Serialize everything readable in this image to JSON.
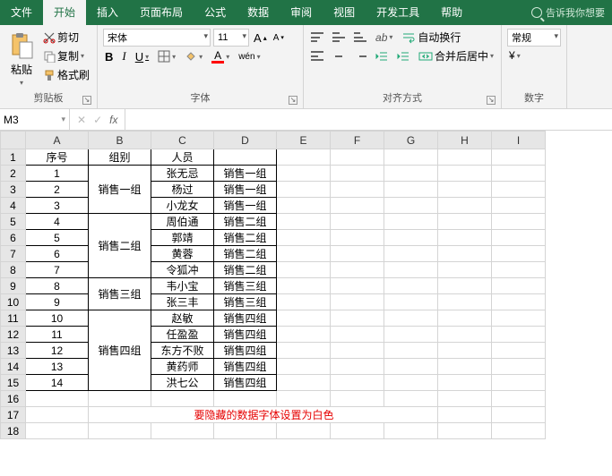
{
  "tabs": {
    "items": [
      "文件",
      "开始",
      "插入",
      "页面布局",
      "公式",
      "数据",
      "审阅",
      "视图",
      "开发工具",
      "帮助"
    ],
    "active_index": 1,
    "tell_me": "告诉我你想要"
  },
  "ribbon": {
    "clipboard": {
      "label": "剪贴板",
      "paste": "粘贴",
      "cut": "剪切",
      "copy": "复制",
      "format_painter": "格式刷"
    },
    "font": {
      "label": "字体",
      "name": "宋体",
      "size": "11",
      "bold": "B",
      "italic": "I",
      "underline": "U",
      "font_color_letter": "A",
      "fill_letter": "A",
      "grow": "A",
      "shrink": "A",
      "phonetic": "wén"
    },
    "alignment": {
      "label": "对齐方式",
      "wrap": "自动换行",
      "merge": "合并后居中"
    },
    "number": {
      "label": "数字",
      "format": "常规"
    }
  },
  "formula_bar": {
    "name_box": "M3",
    "cancel": "✕",
    "enter": "✓",
    "fx": "fx",
    "formula": ""
  },
  "grid": {
    "cols": [
      "A",
      "B",
      "C",
      "D",
      "E",
      "F",
      "G",
      "H",
      "I"
    ],
    "headers": {
      "A": "序号",
      "B": "组别",
      "C": "人员",
      "D": ""
    },
    "rows": [
      {
        "n": "1",
        "a": "1",
        "c": "张无忌",
        "d": "销售一组"
      },
      {
        "n": "2",
        "a": "2",
        "c": "杨过",
        "d": "销售一组"
      },
      {
        "n": "3",
        "a": "3",
        "c": "小龙女",
        "d": "销售一组"
      },
      {
        "n": "4",
        "a": "4",
        "c": "周伯通",
        "d": "销售二组"
      },
      {
        "n": "5",
        "a": "5",
        "c": "郭靖",
        "d": "销售二组"
      },
      {
        "n": "6",
        "a": "6",
        "c": "黄蓉",
        "d": "销售二组"
      },
      {
        "n": "7",
        "a": "7",
        "c": "令狐冲",
        "d": "销售二组"
      },
      {
        "n": "8",
        "a": "8",
        "c": "韦小宝",
        "d": "销售三组"
      },
      {
        "n": "9",
        "a": "9",
        "c": "张三丰",
        "d": "销售三组"
      },
      {
        "n": "10",
        "a": "10",
        "c": "赵敏",
        "d": "销售四组"
      },
      {
        "n": "11",
        "a": "11",
        "c": "任盈盈",
        "d": "销售四组"
      },
      {
        "n": "12",
        "a": "12",
        "c": "东方不败",
        "d": "销售四组"
      },
      {
        "n": "13",
        "a": "13",
        "c": "黄药师",
        "d": "销售四组"
      },
      {
        "n": "14",
        "a": "14",
        "c": "洪七公",
        "d": "销售四组"
      }
    ],
    "merged_b": [
      {
        "start": 0,
        "span": 3,
        "text": "销售一组"
      },
      {
        "start": 3,
        "span": 4,
        "text": "销售二组"
      },
      {
        "start": 7,
        "span": 2,
        "text": "销售三组"
      },
      {
        "start": 9,
        "span": 5,
        "text": "销售四组"
      }
    ],
    "annotation": "要隐藏的数据字体设置为白色"
  }
}
